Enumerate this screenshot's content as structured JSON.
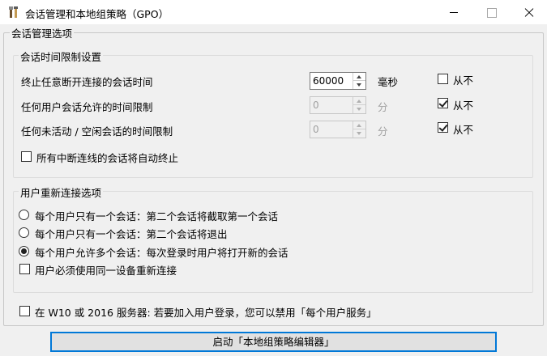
{
  "window": {
    "title": "会话管理和本地组策略（GPO）"
  },
  "session_management": {
    "title": "会话管理选项",
    "time_limits": {
      "title": "会话时间限制设置",
      "rows": [
        {
          "label": "终止任意断开连接的会话时间",
          "value": "60000",
          "unit": "毫秒",
          "never_label": "从不",
          "never_checked": false,
          "enabled": true
        },
        {
          "label": "任何用户会话允许的时间限制",
          "value": "0",
          "unit": "分",
          "never_label": "从不",
          "never_checked": true,
          "enabled": false
        },
        {
          "label": "任何未活动 / 空闲会话的时间限制",
          "value": "0",
          "unit": "分",
          "never_label": "从不",
          "never_checked": true,
          "enabled": false
        }
      ],
      "auto_end_label": "所有中断连线的会话将自动终止",
      "auto_end_checked": false
    },
    "reconnect": {
      "title": "用户重新连接选项",
      "options": [
        {
          "label": "每个用户只有一个会话：第二个会话将截取第一个会话",
          "selected": false
        },
        {
          "label": "每个用户只有一个会话：第二个会话将退出",
          "selected": false
        },
        {
          "label": "每个用户允许多个会话：每次登录时用户将打开新的会话",
          "selected": true
        }
      ],
      "same_device_label": "用户必须使用同一设备重新连接",
      "same_device_checked": false
    },
    "w10_label": "在 W10 或 2016 服务器: 若要加入用户登录，您可以禁用「每个用户服务」",
    "w10_checked": false
  },
  "launch_button": "启动「本地组策略编辑器」",
  "colors": {
    "focus_border": "#0078d7",
    "background": "#f0f0f0"
  }
}
